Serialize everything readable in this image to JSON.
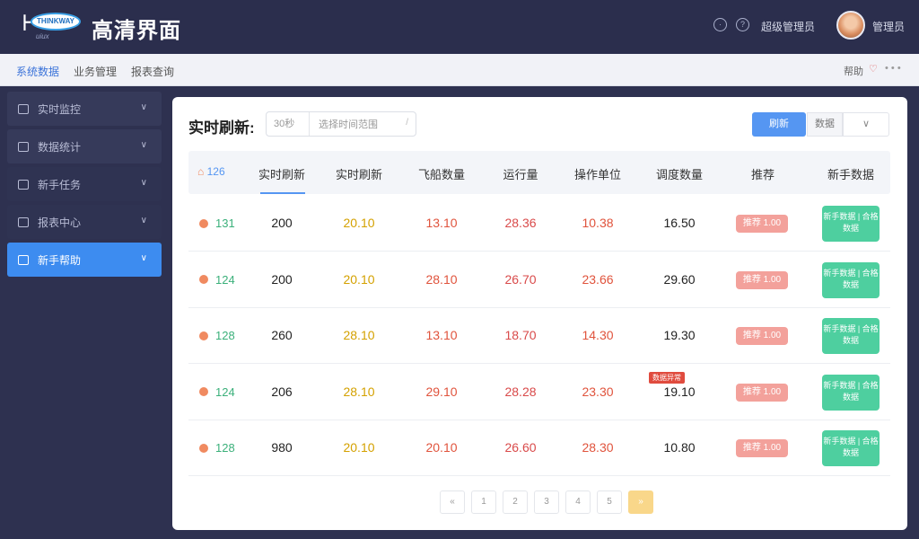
{
  "header": {
    "logo_text": "THINKWAY",
    "logo_sub": "uiux",
    "title": "高清界面",
    "user_label": "超级管理员",
    "user_name": "管理员"
  },
  "subnav": {
    "items": [
      "系统数据",
      "业务管理",
      "报表查询"
    ],
    "right_label": "帮助"
  },
  "sidebar": {
    "items": [
      {
        "label": "实时监控"
      },
      {
        "label": "数据统计"
      },
      {
        "label": "新手任务"
      },
      {
        "label": "报表中心"
      },
      {
        "label": "新手帮助"
      }
    ]
  },
  "card": {
    "title": "实时刷新:",
    "filter_left": "30秒",
    "filter_right": "选择时间范围",
    "btn_primary": "刷新",
    "btn_plain": "数据"
  },
  "table": {
    "columns": [
      "126",
      "实时刷新",
      "实时刷新",
      "飞船数量",
      "运行量",
      "操作单位",
      "调度数量",
      "推荐",
      "新手数据"
    ],
    "rows": [
      {
        "id": "131",
        "c1": "200",
        "c2": "20.10",
        "c3": "13.10",
        "c4": "28.36",
        "c5": "10.38",
        "c6": "16.50",
        "pill": "推荐 1.00",
        "act": "新手数据 | 合格数据"
      },
      {
        "id": "124",
        "c1": "200",
        "c2": "20.10",
        "c3": "28.10",
        "c4": "26.70",
        "c5": "23.66",
        "c6": "29.60",
        "pill": "推荐 1.00",
        "act": "新手数据 | 合格数据"
      },
      {
        "id": "128",
        "c1": "260",
        "c2": "28.10",
        "c3": "13.10",
        "c4": "18.70",
        "c5": "14.30",
        "c6": "19.30",
        "pill": "推荐 1.00",
        "act": "新手数据 | 合格数据"
      },
      {
        "id": "124",
        "c1": "206",
        "c2": "28.10",
        "c3": "29.10",
        "c4": "28.28",
        "c5": "23.30",
        "c6": "19.10",
        "tag": "数据异常",
        "pill": "推荐 1.00",
        "act": "新手数据 | 合格数据"
      },
      {
        "id": "128",
        "c1": "980",
        "c2": "20.10",
        "c3": "20.10",
        "c4": "26.60",
        "c5": "28.30",
        "c6": "10.80",
        "pill": "推荐 1.00",
        "act": "新手数据 | 合格数据"
      }
    ]
  },
  "pager": [
    "«",
    "1",
    "2",
    "3",
    "4",
    "5",
    "»"
  ],
  "colors": {
    "accent": "#3d8cf0",
    "header_bg": "#2b2e4d",
    "success": "#4ecf9f",
    "danger": "#e0533c",
    "warning": "#d4a100"
  }
}
